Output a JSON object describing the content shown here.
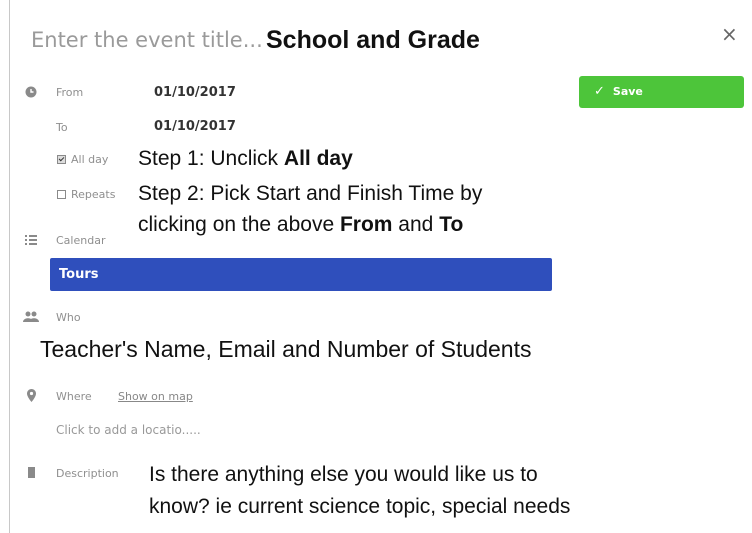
{
  "header": {
    "title_placeholder": "Enter the event title...",
    "title_annotation": "School and Grade",
    "close_icon": "×"
  },
  "when": {
    "from_label": "From",
    "from_value": "01/10/2017",
    "to_label": "To",
    "to_value": "01/10/2017",
    "all_day_label": "All day",
    "all_day_checked": true,
    "repeats_label": "Repeats",
    "repeats_checked": false
  },
  "save": {
    "label": "Save",
    "icon": "✓",
    "color": "#4dc53a"
  },
  "steps": {
    "step1_prefix": "Step 1: Unclick ",
    "step1_bold": "All day",
    "step2_line1": "Step 2: Pick Start and Finish Time by",
    "step2_line2_prefix": "clicking on the above ",
    "step2_from": "From",
    "step2_and": " and ",
    "step2_to": "To"
  },
  "calendar": {
    "label": "Calendar",
    "selected": "Tours",
    "color": "#2f4fbc"
  },
  "who": {
    "label": "Who",
    "annotation": "Teacher's Name, Email and Number of Students"
  },
  "where": {
    "label": "Where",
    "show_on_map": "Show on map",
    "location_placeholder": "Click to add a locatio....."
  },
  "description": {
    "label": "Description",
    "annotation_line1": "Is there anything else you would like us to",
    "annotation_line2": "know? ie current science topic, special needs"
  }
}
